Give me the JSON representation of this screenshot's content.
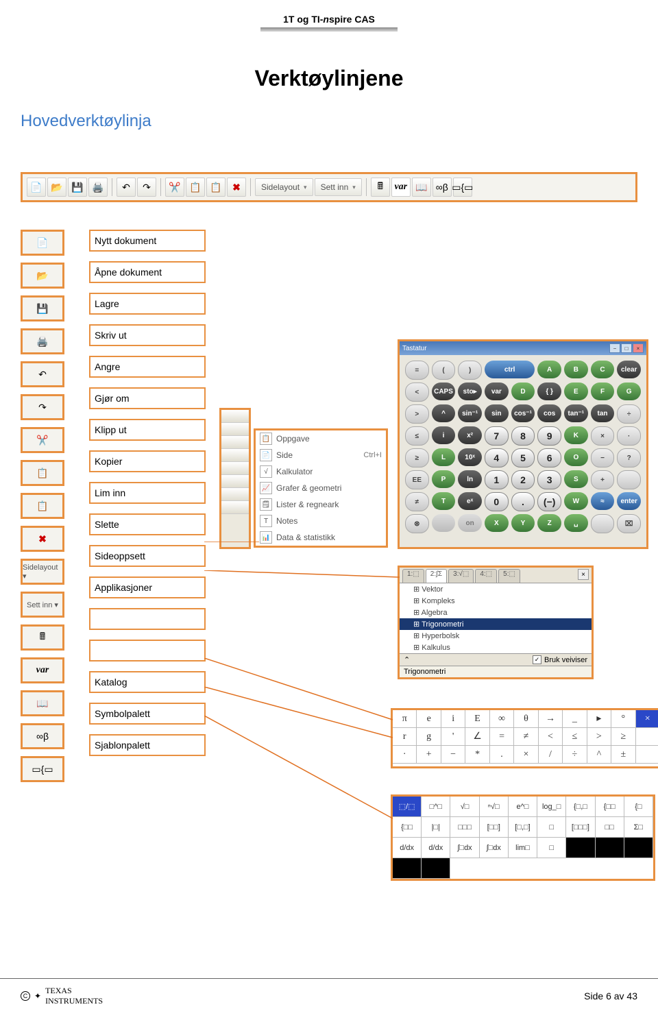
{
  "header": {
    "title_1": "1T og TI-",
    "title_italic": "n",
    "title_2": "spire CAS"
  },
  "h1": "Verktøylinjene",
  "h2": "Hovedverktøylinja",
  "toolbar": {
    "sidelayout": "Sidelayout",
    "settinn": "Sett inn",
    "var": "var"
  },
  "labels": [
    "Nytt dokument",
    "Åpne dokument",
    "Lagre",
    "Skriv ut",
    "Angre",
    "Gjør om",
    "Klipp ut",
    "Kopier",
    "Lim inn",
    "Slette",
    "Sideoppsett",
    "Applikasjoner",
    "",
    "",
    "Katalog",
    "Symbolpalett",
    "Sjablonpalett"
  ],
  "insert_menu": {
    "items": [
      {
        "label": "Oppgave",
        "shortcut": ""
      },
      {
        "label": "Side",
        "shortcut": "Ctrl+I"
      },
      {
        "label": "Kalkulator",
        "shortcut": ""
      },
      {
        "label": "Grafer & geometri",
        "shortcut": ""
      },
      {
        "label": "Lister & regneark",
        "shortcut": ""
      },
      {
        "label": "Notes",
        "shortcut": ""
      },
      {
        "label": "Data & statistikk",
        "shortcut": ""
      }
    ]
  },
  "keypad_window": {
    "title": "Tastatur",
    "rows": [
      [
        {
          "t": "=",
          "c": "klight"
        },
        {
          "t": "(",
          "c": "klight"
        },
        {
          "t": ")",
          "c": "klight"
        },
        {
          "t": "ctrl",
          "c": "kblue",
          "span": 2
        },
        {
          "t": "A",
          "c": "kgreen"
        },
        {
          "t": "B",
          "c": "kgreen"
        },
        {
          "t": "C",
          "c": "kgreen"
        },
        {
          "t": "clear",
          "c": "kdark"
        }
      ],
      [
        {
          "t": "<",
          "c": "klight"
        },
        {
          "t": "CAPS",
          "c": "kdark"
        },
        {
          "t": "sto▸",
          "c": "kdark"
        },
        {
          "t": "var",
          "c": "kdark"
        },
        {
          "t": "D",
          "c": "kgreen"
        },
        {
          "t": "{ }",
          "c": "kdark"
        },
        {
          "t": "E",
          "c": "kgreen"
        },
        {
          "t": "F",
          "c": "kgreen"
        },
        {
          "t": "G",
          "c": "kgreen"
        }
      ],
      [
        {
          "t": ">",
          "c": "klight"
        },
        {
          "t": "^",
          "c": "kdark"
        },
        {
          "t": "sin⁻¹",
          "c": "kdark"
        },
        {
          "t": "sin",
          "c": "kdark"
        },
        {
          "t": "cos⁻¹",
          "c": "kdark"
        },
        {
          "t": "cos",
          "c": "kdark"
        },
        {
          "t": "tan⁻¹",
          "c": "kdark"
        },
        {
          "t": "tan",
          "c": "kdark"
        },
        {
          "t": "÷",
          "c": "klight"
        }
      ],
      [
        {
          "t": "≤",
          "c": "klight"
        },
        {
          "t": "i",
          "c": "kdark"
        },
        {
          "t": "x²",
          "c": "kdark"
        },
        {
          "t": "7",
          "c": "knum"
        },
        {
          "t": "8",
          "c": "knum"
        },
        {
          "t": "9",
          "c": "knum"
        },
        {
          "t": "K",
          "c": "kgreen"
        },
        {
          "t": "×",
          "c": "klight"
        },
        {
          "t": "·",
          "c": "klight"
        }
      ],
      [
        {
          "t": "≥",
          "c": "klight"
        },
        {
          "t": "L",
          "c": "kgreen"
        },
        {
          "t": "10ˣ",
          "c": "kdark"
        },
        {
          "t": "4",
          "c": "knum"
        },
        {
          "t": "5",
          "c": "knum"
        },
        {
          "t": "6",
          "c": "knum"
        },
        {
          "t": "O",
          "c": "kgreen"
        },
        {
          "t": "−",
          "c": "klight"
        },
        {
          "t": "?",
          "c": "klight"
        }
      ],
      [
        {
          "t": "EE",
          "c": "klight"
        },
        {
          "t": "P",
          "c": "kgreen"
        },
        {
          "t": "ln",
          "c": "kdark"
        },
        {
          "t": "1",
          "c": "knum"
        },
        {
          "t": "2",
          "c": "knum"
        },
        {
          "t": "3",
          "c": "knum"
        },
        {
          "t": "S",
          "c": "kgreen"
        },
        {
          "t": "+",
          "c": "klight"
        },
        {
          "t": "",
          "c": "klight"
        }
      ],
      [
        {
          "t": "≠",
          "c": "klight"
        },
        {
          "t": "T",
          "c": "kgreen"
        },
        {
          "t": "eˣ",
          "c": "kdark"
        },
        {
          "t": "0",
          "c": "knum"
        },
        {
          "t": ".",
          "c": "knum"
        },
        {
          "t": "(−)",
          "c": "knum"
        },
        {
          "t": "W",
          "c": "kgreen"
        },
        {
          "t": "≈",
          "c": "kblue"
        },
        {
          "t": "enter",
          "c": "kblue"
        }
      ],
      [
        {
          "t": "⊗",
          "c": "klight"
        },
        {
          "t": "",
          "c": "koff"
        },
        {
          "t": "on",
          "c": "koff"
        },
        {
          "t": "X",
          "c": "kgreen"
        },
        {
          "t": "Y",
          "c": "kgreen"
        },
        {
          "t": "Z",
          "c": "kgreen"
        },
        {
          "t": "␣",
          "c": "kgreen"
        },
        {
          "t": "",
          "c": "klight"
        },
        {
          "t": "⌧",
          "c": "klight"
        }
      ]
    ]
  },
  "catalog": {
    "tabs": [
      "1:⬚",
      "2:∫Σ",
      "3:√⬚",
      "4:⬚",
      "5:⬚"
    ],
    "items": [
      "Vektor",
      "Kompleks",
      "Algebra",
      "Trigonometri",
      "Hyperbolsk",
      "Kalkulus"
    ],
    "selected": 3,
    "wizard_label": "Bruk veiviser",
    "status": "Trigonometri"
  },
  "symbols": {
    "rows": [
      [
        "π",
        "e",
        "i",
        "E",
        "∞",
        "θ",
        "→",
        "_",
        "▸",
        "°",
        "×"
      ],
      [
        "r",
        "g",
        "'",
        "∠",
        "=",
        "≠",
        "<",
        "≤",
        ">",
        "≥",
        ""
      ],
      [
        "·",
        "+",
        "−",
        "*",
        ".",
        "×",
        "/",
        "÷",
        "^",
        "±",
        ""
      ]
    ]
  },
  "templates": {
    "rows": [
      [
        "⬚/⬚",
        "□^□",
        "√□",
        "ⁿ√□",
        "e^□",
        "log_□",
        "{□,□",
        "{□□",
        "{□",
        "{□□"
      ],
      [
        "|□|",
        "□□□",
        "[□□]",
        "[□,□]",
        "□",
        "[□□□]",
        "□□",
        "Σ□",
        "d/dx",
        "d/dx"
      ],
      [
        "∫□dx",
        "∫□dx",
        "lim□",
        "□",
        " ",
        " ",
        " ",
        " ",
        " "
      ]
    ]
  },
  "footer": {
    "brand1": "TEXAS",
    "brand2": "INSTRUMENTS",
    "page": "Side 6 av 43"
  }
}
